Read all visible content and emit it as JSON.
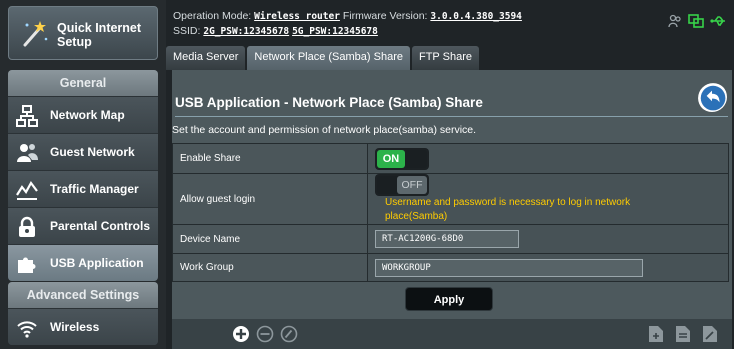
{
  "sidebar": {
    "quick_setup_label": "Quick Internet Setup",
    "general_header": "General",
    "general_items": [
      {
        "label": "Network Map",
        "icon": "network-map-icon"
      },
      {
        "label": "Guest Network",
        "icon": "guest-network-icon"
      },
      {
        "label": "Traffic Manager",
        "icon": "traffic-manager-icon"
      },
      {
        "label": "Parental Controls",
        "icon": "parental-controls-icon"
      },
      {
        "label": "USB Application",
        "icon": "usb-application-icon",
        "active": true
      }
    ],
    "advanced_header": "Advanced Settings",
    "advanced_items": [
      {
        "label": "Wireless",
        "icon": "wireless-icon"
      }
    ]
  },
  "status": {
    "operation_mode_label": "Operation Mode:",
    "operation_mode_value": "Wireless router",
    "firmware_label": "Firmware Version:",
    "firmware_value": "3.0.0.4.380_3594",
    "ssid_label": "SSID:",
    "ssid_24": "2G_PSW:12345678",
    "ssid_5": "5G_PSW:12345678"
  },
  "tabs": [
    {
      "label": "Media Server"
    },
    {
      "label": "Network Place (Samba) Share",
      "active": true
    },
    {
      "label": "FTP Share"
    }
  ],
  "main": {
    "title": "USB Application - Network Place (Samba) Share",
    "description": "Set the account and permission of network place(samba) service.",
    "enable_share_label": "Enable Share",
    "enable_share_state": "ON",
    "guest_login_label": "Allow guest login",
    "guest_login_state": "OFF",
    "guest_login_warning": "Username and password is necessary to log in network place(Samba)",
    "device_name_label": "Device Name",
    "device_name_value": "RT-AC1200G-68D0",
    "work_group_label": "Work Group",
    "work_group_value": "WORKGROUP",
    "apply_label": "Apply"
  },
  "colors": {
    "accent_green": "#2cb24a",
    "warning_yellow": "#ffcc00",
    "panel_bg": "#4d595d"
  }
}
